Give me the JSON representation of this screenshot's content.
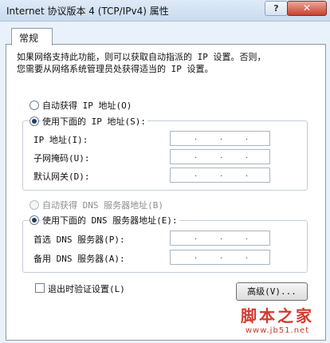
{
  "window": {
    "title": "Internet 协议版本 4 (TCP/IPv4) 属性",
    "help_label": "?",
    "close_label": "✕"
  },
  "tabs": [
    {
      "label": "常规"
    }
  ],
  "description": [
    "如果网络支持此功能，则可以获取自动指派的 IP 设置。否则，",
    "您需要从网络系统管理员处获得适当的 IP 设置。"
  ],
  "ip_group": {
    "auto_label": "自动获得 IP 地址(O)",
    "manual_label": "使用下面的 IP 地址(S):",
    "selected": "manual",
    "fields": [
      {
        "label": "IP 地址(I):",
        "value": ". . ."
      },
      {
        "label": "子网掩码(U):",
        "value": ". . ."
      },
      {
        "label": "默认网关(D):",
        "value": ". . ."
      }
    ]
  },
  "dns_group": {
    "auto_label": "自动获得 DNS 服务器地址(B)",
    "auto_disabled": true,
    "manual_label": "使用下面的 DNS 服务器地址(E):",
    "selected": "manual",
    "fields": [
      {
        "label": "首选 DNS 服务器(P):",
        "value": ". . ."
      },
      {
        "label": "备用 DNS 服务器(A):",
        "value": ". . ."
      }
    ]
  },
  "validate_on_exit": {
    "label": "退出时验证设置(L)",
    "checked": false
  },
  "advanced_button": "高级(V)...",
  "watermark": {
    "line1": "脚本之家",
    "line2": "www.jb51.net"
  },
  "colors": {
    "titlebar": "#c9dbef",
    "close_button": "#c8402e",
    "window_bg": "#e9f1fa",
    "watermark": "#d43a2f"
  },
  "icons": {
    "help": "question-mark-icon",
    "close": "close-x-icon"
  }
}
